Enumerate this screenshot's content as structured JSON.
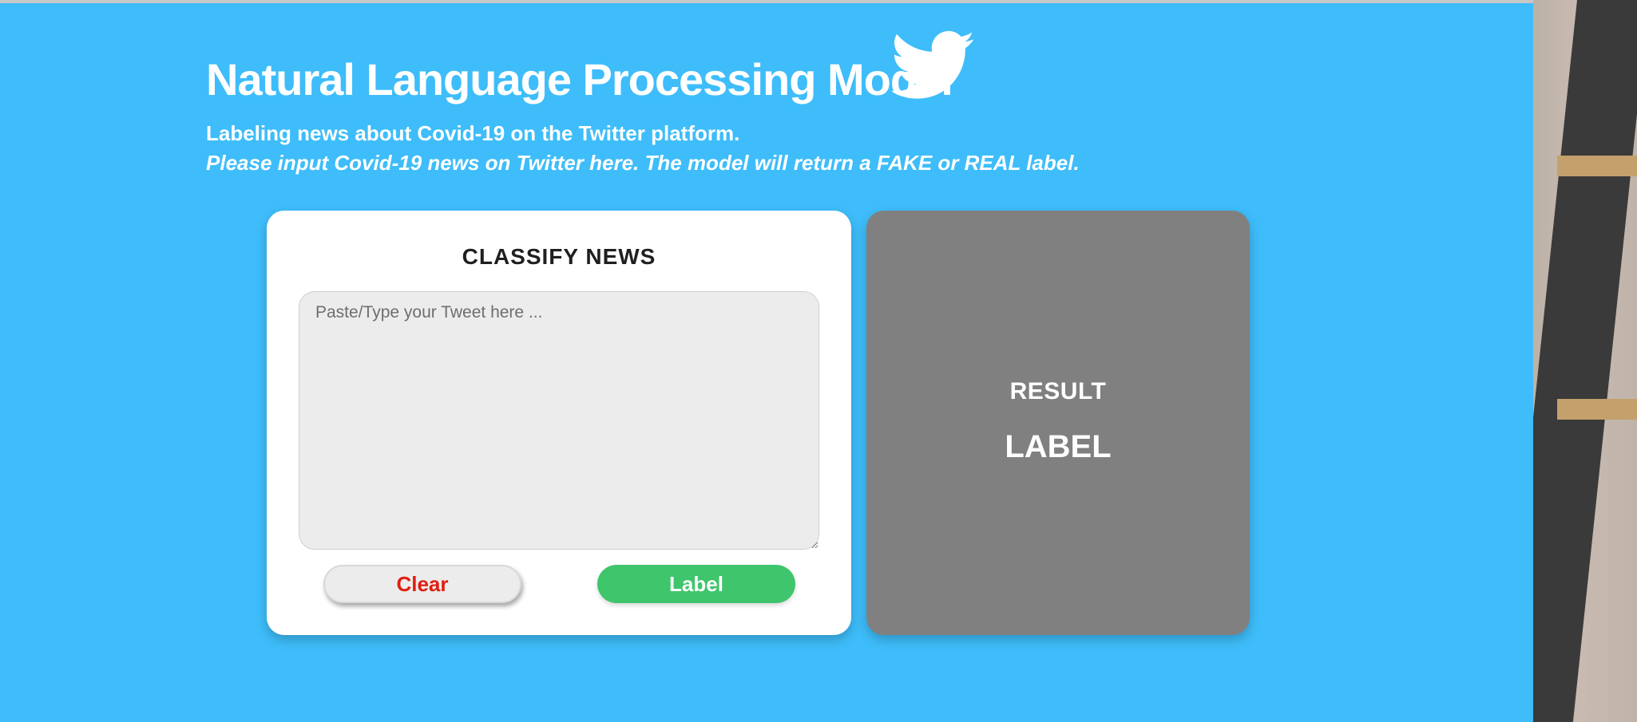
{
  "header": {
    "title": "Natural Language Processing Model",
    "subtitle": "Labeling news about Covid-19 on the Twitter platform.",
    "instruction": "Please input Covid-19 news on Twitter here. The model will return a FAKE or REAL label.",
    "logo_icon": "twitter-bird-icon"
  },
  "classifier": {
    "title": "CLASSIFY NEWS",
    "input_value": "",
    "input_placeholder": "Paste/Type your Tweet here ...",
    "clear_label": "Clear",
    "label_button": "Label"
  },
  "result": {
    "title": "RESULT",
    "label": "LABEL"
  },
  "colors": {
    "background": "#3ebdfa",
    "card": "#ffffff",
    "result_panel": "#808080",
    "clear_text": "#e01e10",
    "label_button": "#3fc56c"
  }
}
